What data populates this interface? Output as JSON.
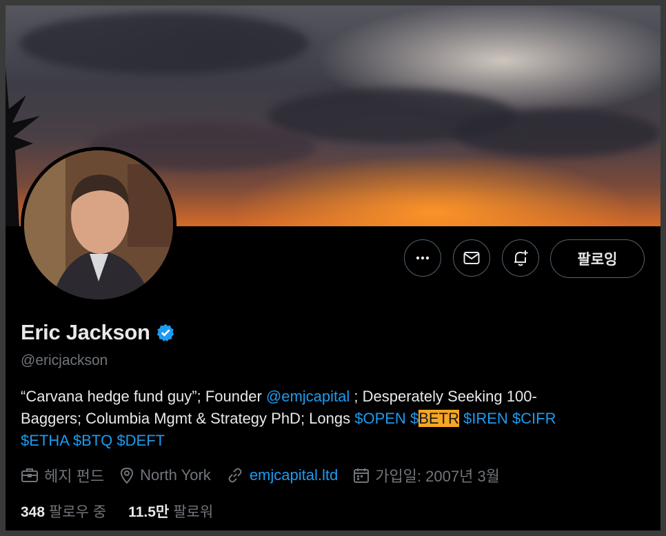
{
  "profile": {
    "name": "Eric Jackson",
    "handle": "@ericjackson",
    "follow_label": "팔로잉",
    "bio": {
      "line1_a": "“Carvana hedge fund guy”; Founder ",
      "mention": "@emjcapital",
      "line1_b": " ; Desperately Seeking 100-",
      "line2_a": "Baggers; Columbia Mgmt & Strategy PhD; Longs ",
      "tag_open": "$OPEN",
      "tag_betr_prefix": "$",
      "tag_betr_highlight": "BETR",
      "tag_iren": "$IREN",
      "tag_cifr": "$CIFR",
      "tag_etha": "$ETHA",
      "tag_btq": "$BTQ",
      "tag_deft": "$DEFT"
    },
    "meta": {
      "category": "헤지 펀드",
      "location": "North York",
      "website": "emjcapital.ltd",
      "joined": "가입일: 2007년 3월"
    },
    "stats": {
      "following_count": "348",
      "following_label": "팔로우 중",
      "followers_count": "11.5만",
      "followers_label": "팔로워"
    }
  },
  "icons": {
    "more": "more-horizontal-icon",
    "message": "envelope-icon",
    "notify": "bell-plus-icon",
    "verified": "verified-badge-icon",
    "category": "briefcase-icon",
    "location": "map-pin-icon",
    "website": "link-icon",
    "joined": "calendar-icon"
  },
  "colors": {
    "accent": "#1d9bf0",
    "highlight": "#f5a623",
    "text": "#e7e9ea",
    "muted": "#71767b",
    "border": "#536471"
  }
}
